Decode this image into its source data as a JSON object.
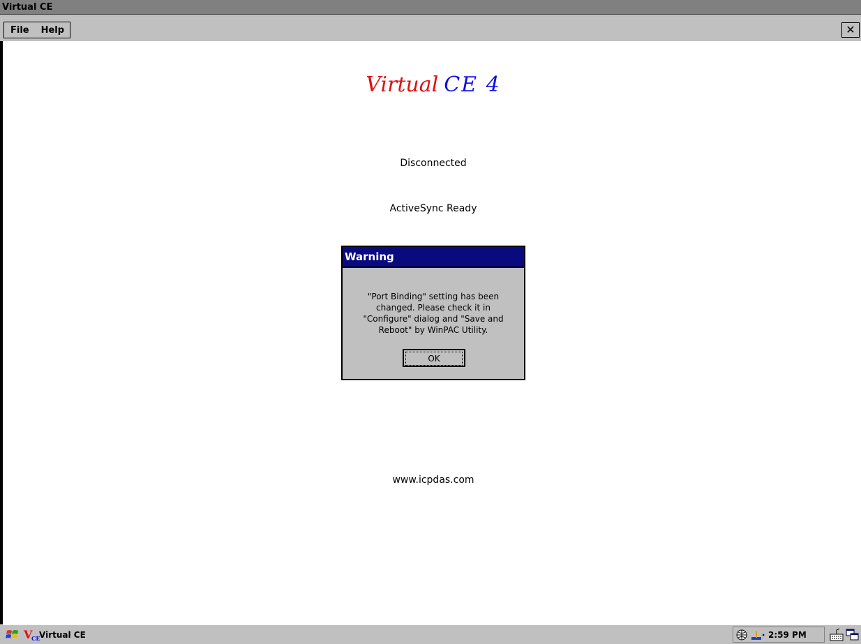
{
  "window": {
    "title": "Virtual CE",
    "menu": [
      {
        "label": "File"
      },
      {
        "label": "Help"
      }
    ],
    "close_label": "✕"
  },
  "content": {
    "logo_part1": "Virtual",
    "logo_part2": "CE 4",
    "status": "Disconnected",
    "activesync": "ActiveSync Ready",
    "website": "www.icpdas.com"
  },
  "dialog": {
    "title": "Warning",
    "message": "\"Port Binding\" setting has been\nchanged. Please check it in\n\"Configure\" dialog and  \"Save and\nReboot\" by WinPAC Utility.",
    "ok_label": "OK"
  },
  "taskbar": {
    "app_label": "Virtual CE",
    "time": "2:59 PM",
    "icons": [
      "start-icon",
      "network-icon",
      "connection-icon",
      "keyboard-icon",
      "desktop-icon"
    ]
  },
  "colors": {
    "titlebar": "#808080",
    "dialog_title": "#0a0a80",
    "logo_red": "#e01010",
    "logo_blue": "#1010e0"
  }
}
